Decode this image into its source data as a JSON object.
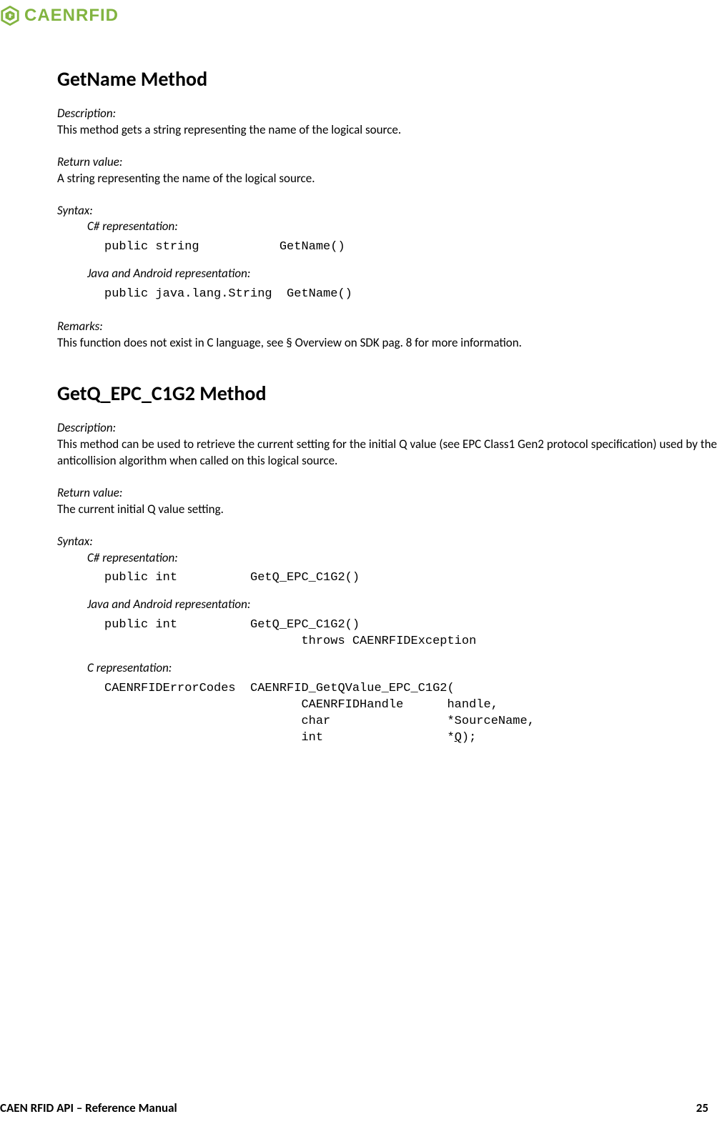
{
  "header": {
    "logo_text": "CAENRFID"
  },
  "section1": {
    "title": "GetName Method",
    "desc_label": "Description:",
    "desc_text": "This method gets a string representing the name of the logical source.",
    "retval_label": "Return value:",
    "retval_text": "A string representing the name of the logical source.",
    "syntax_label": "Syntax:",
    "csharp_label": "C# representation:",
    "csharp_code": "public string           GetName()",
    "java_label": "Java and Android representation:",
    "java_code": "public java.lang.String  GetName()",
    "remarks_label": "Remarks:",
    "remarks_text": "This function does not exist in C language, see § Overview on SDK pag. 8 for more information."
  },
  "section2": {
    "title": "GetQ_EPC_C1G2 Method",
    "desc_label": "Description:",
    "desc_text": "This method can be used to retrieve the current setting for the initial Q value (see EPC Class1 Gen2 protocol specification) used by the anticollision algorithm when called on this logical source.",
    "retval_label": "Return value:",
    "retval_text": "The current initial Q value setting.",
    "syntax_label": "Syntax:",
    "csharp_label": "C# representation:",
    "csharp_code": "public int          GetQ_EPC_C1G2()",
    "java_label": "Java and Android representation:",
    "java_code": "public int          GetQ_EPC_C1G2()\n                           throws CAENRFIDException",
    "c_label": "C representation:",
    "c_code_pre": "CAENRFIDErrorCodes  CAENRFID_GetQValue_EPC_C1G2(\n                           CAENRFIDHandle      handle,\n                           char                *SourceName,\n                           int                 *",
    "c_code_q": "Q",
    "c_code_post": ");"
  },
  "footer": {
    "title": "CAEN RFID API – Reference Manual",
    "page": "25"
  }
}
